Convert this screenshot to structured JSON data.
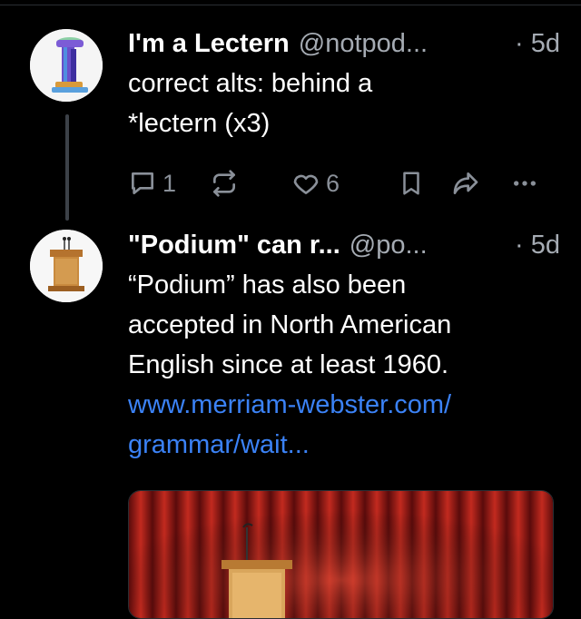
{
  "thread": {
    "posts": [
      {
        "display_name": "I'm a Lectern",
        "handle": "@notpod...",
        "timestamp": "· 5d",
        "avatar_icon": "lectern-avatar",
        "text_lines": [
          "correct alts: behind a",
          "*lectern (x3)"
        ],
        "actions": {
          "reply_count": "1",
          "repost_count": "",
          "like_count": "6"
        }
      },
      {
        "display_name": "\"Podium\" can r...",
        "handle": "@po...",
        "timestamp": "· 5d",
        "avatar_icon": "podium-avatar",
        "text_lines": [
          "“Podium” has also been",
          "accepted in North American",
          "English since at least 1960."
        ],
        "link_lines": [
          "www.merriam-webster.com/",
          "grammar/wait..."
        ]
      }
    ]
  },
  "colors": {
    "background": "#000000",
    "text": "#ffffff",
    "muted": "#a5abb3",
    "icon": "#8a9099",
    "link": "#3b82f6",
    "thread_line": "#3c4148"
  }
}
